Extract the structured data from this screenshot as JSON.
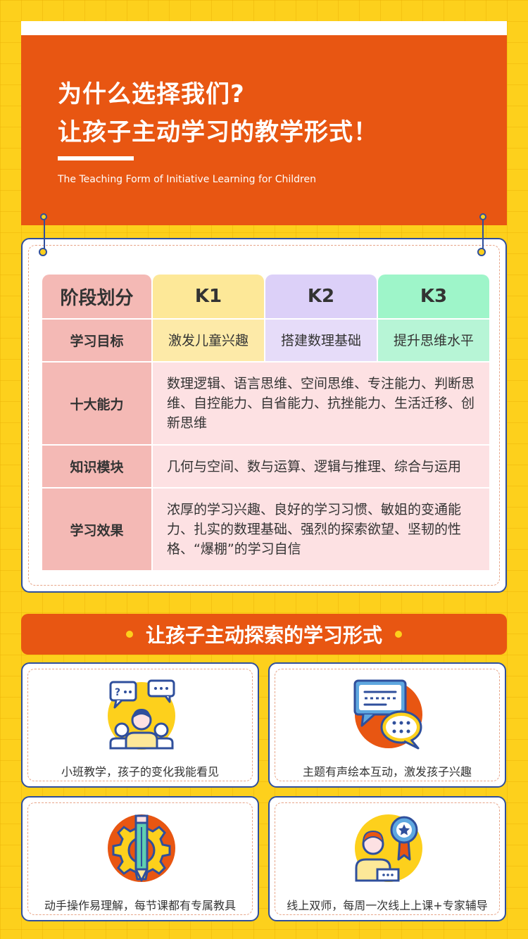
{
  "hero": {
    "title_line1": "为什么选择我们?",
    "title_line2": "让孩子主动学习的教学形式！",
    "subtitle": "The Teaching Form of Initiative Learning for Children"
  },
  "table": {
    "header": [
      "阶段划分",
      "K1",
      "K2",
      "K3"
    ],
    "header_colors": [
      "#f4b9b5",
      "#fde898",
      "#dcd0f8",
      "#9ef5c9"
    ],
    "goals": {
      "label": "学习目标",
      "values": [
        "激发儿童兴趣",
        "搭建数理基础",
        "提升思维水平"
      ]
    },
    "abilities": {
      "label": "十大能力",
      "value": "数理逻辑、语言思维、空间思维、专注能力、判断思维、自控能力、自省能力、抗挫能力、生活迁移、创新思维"
    },
    "modules": {
      "label": "知识模块",
      "value": "几何与空间、数与运算、逻辑与推理、综合与运用"
    },
    "effects": {
      "label": "学习效果",
      "value": "浓厚的学习兴趣、良好的学习习惯、敏姐的变通能力、扎实的数理基础、强烈的探索欲望、坚韧的性格、“爆棚”的学习自信"
    }
  },
  "section": {
    "title": "让孩子主动探索的学习形式"
  },
  "features": [
    {
      "icon": "small-class-icon",
      "caption": "小班教学，孩子的变化我能看见"
    },
    {
      "icon": "chat-bubbles-icon",
      "caption": "主题有声绘本互动，激发孩子兴趣"
    },
    {
      "icon": "gear-pencil-icon",
      "caption": "动手操作易理解，每节课都有专属教具"
    },
    {
      "icon": "teacher-award-icon",
      "caption": "线上双师，每周一次线上上课+专家辅导"
    }
  ],
  "colors": {
    "background": "#fdd01c",
    "accent_orange": "#e85612",
    "border_blue": "#2f4f9c",
    "label_pink": "#f4b9b5",
    "value_pink": "#fde1e3"
  }
}
